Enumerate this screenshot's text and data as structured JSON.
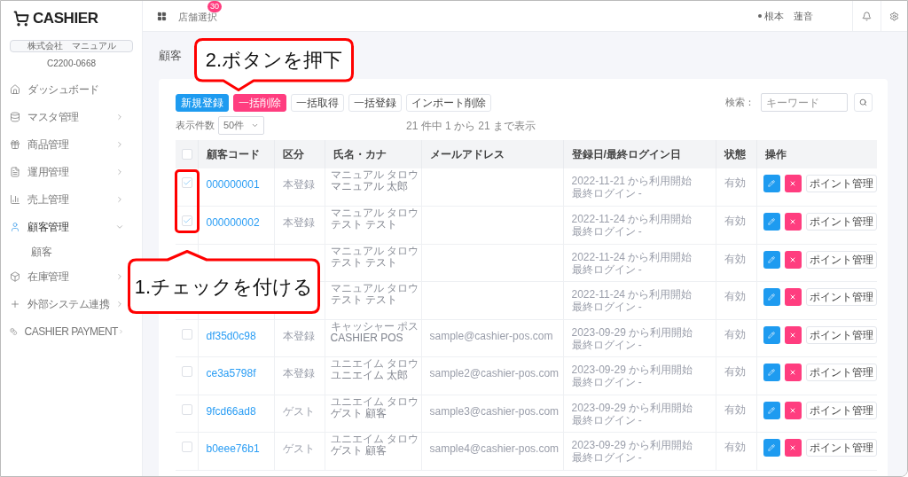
{
  "header": {
    "store_select": "店舗選択",
    "badge": "30",
    "user": "根本　蓮音"
  },
  "sidebar": {
    "logo": "CASHIER",
    "company": "株式会社　マニュアル",
    "company_code": "C2200-0668",
    "items": [
      {
        "label": "ダッシュボード",
        "selected": false
      },
      {
        "label": "マスタ管理",
        "selected": false,
        "expanded": false
      },
      {
        "label": "商品管理",
        "selected": false,
        "expanded": false
      },
      {
        "label": "運用管理",
        "selected": false,
        "expanded": false
      },
      {
        "label": "売上管理",
        "selected": false,
        "expanded": false
      },
      {
        "label": "顧客管理",
        "selected": true,
        "expanded": true,
        "children": [
          {
            "label": "顧客"
          }
        ]
      },
      {
        "label": "在庫管理",
        "selected": false,
        "expanded": false
      },
      {
        "label": "外部システム連携",
        "selected": false,
        "expanded": false
      },
      {
        "label": "CASHIER PAYMENT",
        "selected": false,
        "expanded": false
      }
    ]
  },
  "page_title": "顧客",
  "toolbar": {
    "buttons": [
      {
        "label": "新規登録",
        "kind": "primary"
      },
      {
        "label": "一括削除",
        "kind": "danger"
      },
      {
        "label": "一括取得",
        "kind": "default"
      },
      {
        "label": "一括登録",
        "kind": "default"
      },
      {
        "label": "インポート削除",
        "kind": "default"
      }
    ],
    "search_label": "検索：",
    "search_placeholder": "キーワード",
    "page_size_label": "表示件数",
    "page_size": "50件",
    "summary": "21 件中 1 から 21 まで表示"
  },
  "table": {
    "select_all_checked": false,
    "columns": [
      "顧客コード",
      "区分",
      "氏名・カナ",
      "メールアドレス",
      "登録日/最終ログイン日",
      "状態",
      "操作"
    ],
    "rows": [
      {
        "checked": true,
        "code": "000000001",
        "type": "本登録",
        "kana": "マニュアル タロウ",
        "name": "マニュアル 太郎",
        "registered": "2022-11-21 から利用開始",
        "last_login": "最終ログイン -",
        "status": "有効",
        "action": "ポイント管理"
      },
      {
        "checked": true,
        "code": "000000002",
        "type": "本登録",
        "kana": "マニュアル タロウ",
        "name": "テスト テスト",
        "registered": "2022-11-24 から利用開始",
        "last_login": "最終ログイン -",
        "status": "有効",
        "action": "ポイント管理"
      },
      {
        "kana": "マニュアル タロウ",
        "name": "テスト テスト",
        "registered": "2022-11-24 から利用開始",
        "last_login": "最終ログイン -",
        "status": "有効",
        "action": "ポイント管理"
      },
      {
        "kana": "マニュアル タロウ",
        "name": "テスト テスト",
        "registered": "2022-11-24 から利用開始",
        "last_login": "最終ログイン -",
        "status": "有効",
        "action": "ポイント管理"
      },
      {
        "checked": false,
        "code": "df35d0c98",
        "type": "本登録",
        "kana": "キャッシャー ポス",
        "name": "CASHIER POS",
        "email": "sample@cashier-pos.com",
        "registered": "2023-09-29 から利用開始",
        "last_login": "最終ログイン -",
        "status": "有効",
        "action": "ポイント管理"
      },
      {
        "checked": false,
        "code": "ce3a5798f",
        "type": "本登録",
        "kana": "ユニエイム タロウ",
        "name": "ユニエイム 太郎",
        "email": "sample2@cashier-pos.com",
        "registered": "2023-09-29 から利用開始",
        "last_login": "最終ログイン -",
        "status": "有効",
        "action": "ポイント管理"
      },
      {
        "checked": false,
        "code": "9fcd66ad8",
        "type": "ゲスト",
        "kana": "ユニエイム タロウ",
        "name": "ゲスト 顧客",
        "email": "sample3@cashier-pos.com",
        "registered": "2023-09-29 から利用開始",
        "last_login": "最終ログイン -",
        "status": "有効",
        "action": "ポイント管理"
      },
      {
        "checked": false,
        "code": "b0eee76b1",
        "type": "ゲスト",
        "kana": "ユニエイム タロウ",
        "name": "ゲスト 顧客",
        "email": "sample4@cashier-pos.com",
        "registered": "2023-09-29 から利用開始",
        "last_login": "最終ログイン -",
        "status": "有効",
        "action": "ポイント管理"
      }
    ]
  },
  "annotations": [
    {
      "text": "2.ボタンを押下"
    },
    {
      "text": "1.チェックを付ける"
    }
  ]
}
